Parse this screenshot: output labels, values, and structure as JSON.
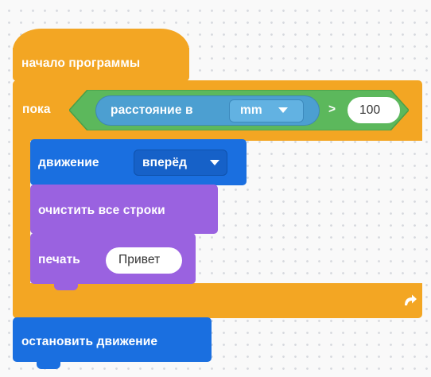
{
  "colors": {
    "events": "#f3a623",
    "control": "#f3a623",
    "condition": "#5cb85c",
    "sensor": "#4c9fd1",
    "motion": "#1a6fe0",
    "display": "#9a62e0"
  },
  "blocks": {
    "start": {
      "label": "начало программы"
    },
    "while": {
      "label": "пока",
      "distance_label": "расстояние в",
      "unit_value": "mm",
      "operator": ">",
      "threshold": "100",
      "loop_icon": "loop-arrow-icon"
    },
    "move": {
      "label": "движение",
      "direction_value": "вперёд"
    },
    "clear": {
      "label": "очистить все строки"
    },
    "print": {
      "label": "печать",
      "text_value": "Привет"
    },
    "stop": {
      "label": "остановить движение"
    }
  }
}
